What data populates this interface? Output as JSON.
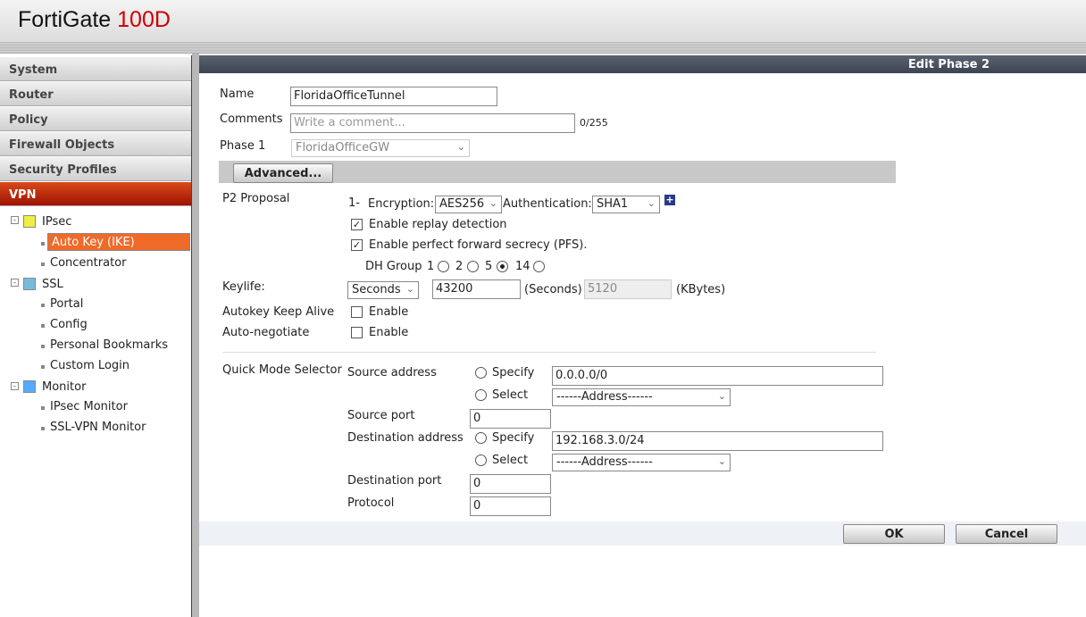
{
  "header": {
    "brand": "FortiGate",
    "model": "100D"
  },
  "sidebar": {
    "menus": [
      "System",
      "Router",
      "Policy",
      "Firewall Objects",
      "Security Profiles",
      "VPN"
    ],
    "tree": [
      {
        "label": "IPsec",
        "children": [
          "Auto Key (IKE)",
          "Concentrator"
        ]
      },
      {
        "label": "SSL",
        "children": [
          "Portal",
          "Config",
          "Personal Bookmarks",
          "Custom Login"
        ]
      },
      {
        "label": "Monitor",
        "children": [
          "IPsec Monitor",
          "SSL-VPN Monitor"
        ]
      }
    ]
  },
  "main": {
    "title": "Edit Phase 2",
    "name_label": "Name",
    "name_value": "FloridaOfficeTunnel",
    "comments_label": "Comments",
    "comments_placeholder": "Write a comment...",
    "comments_count": "0/255",
    "phase1_label": "Phase 1",
    "phase1_value": "FloridaOfficeGW",
    "advanced_button": "Advanced...",
    "p2_label": "P2 Proposal",
    "proposal_index": "1-",
    "encryption_label": "Encryption:",
    "encryption_value": "AES256",
    "auth_label": "Authentication:",
    "auth_value": "SHA1",
    "replay_label": "Enable replay detection",
    "pfs_label": "Enable perfect forward secrecy (PFS).",
    "dh_label": "DH Group",
    "dh_options": [
      "1",
      "2",
      "5",
      "14"
    ],
    "dh_selected": "5",
    "keylife_label": "Keylife:",
    "keylife_unit": "Seconds",
    "keylife_seconds": "43200",
    "seconds_label": "(Seconds)",
    "keylife_kbytes": "5120",
    "kbytes_label": "(KBytes)",
    "keepalive_label": "Autokey Keep Alive",
    "autoneg_label": "Auto-negotiate",
    "enable_label": "Enable",
    "qms_label": "Quick Mode Selector",
    "src_addr_label": "Source address",
    "specify_label": "Specify",
    "select_label": "Select",
    "src_addr_value": "0.0.0.0/0",
    "address_placeholder": "------Address------",
    "src_port_label": "Source port",
    "src_port_value": "0",
    "dst_addr_label": "Destination address",
    "dst_addr_value": "192.168.3.0/24",
    "dst_port_label": "Destination port",
    "dst_port_value": "0",
    "protocol_label": "Protocol",
    "protocol_value": "0",
    "ok_button": "OK",
    "cancel_button": "Cancel"
  }
}
